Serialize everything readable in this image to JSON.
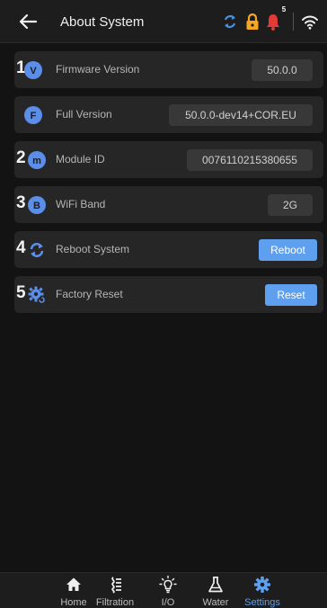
{
  "header": {
    "title": "About System",
    "notification_count": "5",
    "icons": [
      "back-arrow-icon",
      "sync-icon",
      "lock-icon",
      "bell-icon",
      "wifi-icon"
    ],
    "colors": {
      "sync": "#4a90e2",
      "lock": "#f5a623",
      "bell": "#e53935"
    }
  },
  "rows": [
    {
      "number": "1",
      "icon": "firmware-v-icon",
      "label": "Firmware Version",
      "value": "50.0.0"
    },
    {
      "number": "",
      "icon": "full-version-f-icon",
      "label": "Full Version",
      "value": "50.0.0-dev14+COR.EU"
    },
    {
      "number": "2",
      "icon": "module-m-icon",
      "label": "Module ID",
      "value": "0076110215380655"
    },
    {
      "number": "3",
      "icon": "wifi-band-b-icon",
      "label": "WiFi Band",
      "value": "2G"
    },
    {
      "number": "4",
      "icon": "reboot-icon",
      "label": "Reboot System",
      "button": "Reboot"
    },
    {
      "number": "5",
      "icon": "factory-reset-gear-icon",
      "label": "Factory Reset",
      "button": "Reset"
    }
  ],
  "nav": {
    "active": "Settings",
    "accent_color": "#5ea0ef",
    "items": [
      {
        "label": "Home",
        "icon": "home-icon"
      },
      {
        "label": "Filtration",
        "icon": "filtration-icon"
      },
      {
        "label": "I/O",
        "icon": "lightbulb-icon"
      },
      {
        "label": "Water",
        "icon": "flask-icon"
      },
      {
        "label": "Settings",
        "icon": "settings-gear-icon"
      }
    ]
  }
}
